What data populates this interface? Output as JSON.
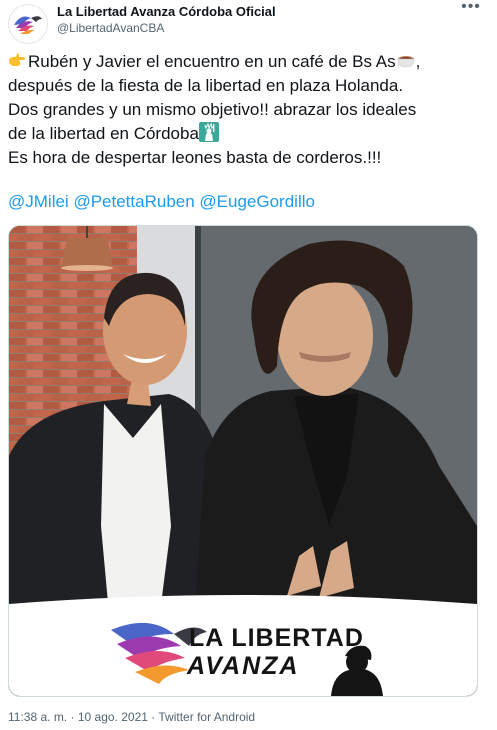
{
  "account": {
    "display_name": "La Libertad Avanza Córdoba Oficial",
    "handle": "@LibertadAvanCBA"
  },
  "more_icon": "more-horizontal-icon",
  "tweet": {
    "line1_text": "Rubén y Javier el encuentro en un café de Bs As",
    "line1_end": ",",
    "line2": "después de la fiesta de la libertad en plaza Holanda.",
    "line3": "Dos grandes y un mismo objetivo!! abrazar los ideales",
    "line4_text": "de la libertad en Córdoba",
    "line5": "Es hora de despertar leones basta de corderos.!!!",
    "emoji_start": "handshake-hand-icon",
    "emoji_coffee": "coffee-cup-icon",
    "emoji_liberty": "statue-of-liberty-icon"
  },
  "mentions": [
    "@JMilei",
    "@PetettaRuben",
    "@EugeGordillo"
  ],
  "media": {
    "logo_line1": "LA LIBERTAD",
    "logo_line2": "AVANZA"
  },
  "meta": {
    "time": "11:38 a. m.",
    "separator": "·",
    "date": "10 ago. 2021",
    "source": "Twitter for Android"
  },
  "colors": {
    "link": "#1d9bf0",
    "text": "#0f1419",
    "muted": "#536471"
  }
}
